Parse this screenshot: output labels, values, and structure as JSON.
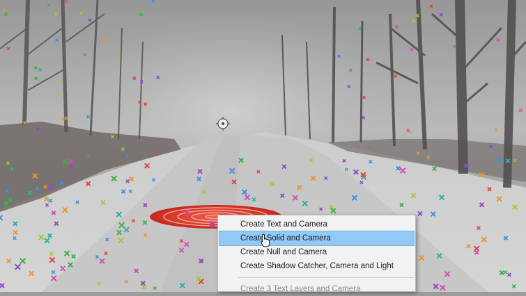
{
  "viewer": {
    "footage_description_icon": "foggy-forest-road-footage",
    "track_point_color_palette": [
      "#3db04a",
      "#8d49c9",
      "#3e8fe0",
      "#e0463a",
      "#2fb0a4",
      "#e8963a",
      "#d14fb5",
      "#a4c83a"
    ],
    "target_color": "#e0463a"
  },
  "context_menu": {
    "items": [
      {
        "label": "Create Text and Camera",
        "state": "normal"
      },
      {
        "label": "Create Solid and Camera",
        "state": "highlighted"
      },
      {
        "label": "Create Null and Camera",
        "state": "normal"
      },
      {
        "label": "Create Shadow Catcher, Camera and Light",
        "state": "normal"
      }
    ],
    "secondary_items": [
      {
        "label": "Create 3 Text Layers and Camera",
        "state": "disabled"
      }
    ]
  }
}
